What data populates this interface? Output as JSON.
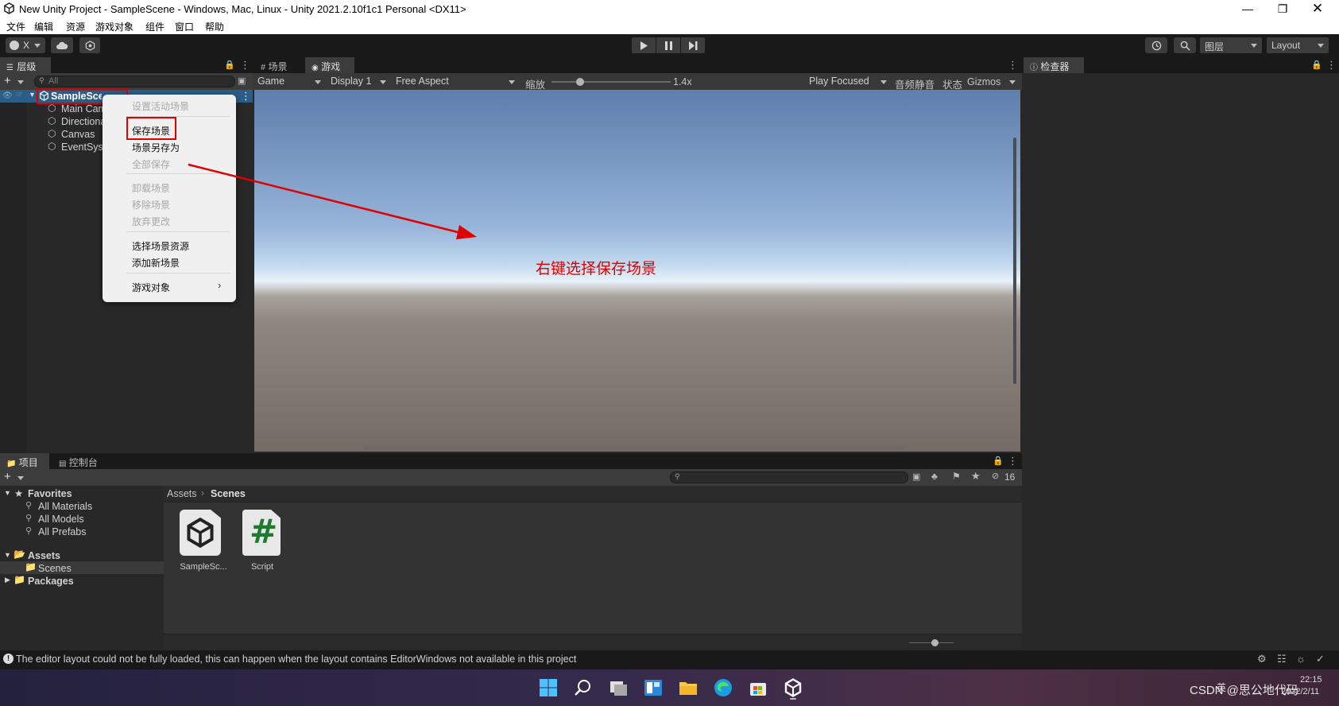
{
  "window": {
    "title": "New Unity Project - SampleScene - Windows, Mac, Linux - Unity 2021.2.10f1c1 Personal <DX11>"
  },
  "menubar": [
    "文件",
    "编辑",
    "资源",
    "游戏对象",
    "组件",
    "窗口",
    "帮助"
  ],
  "toolbar": {
    "account_label": "X",
    "layers_label": "图层",
    "layout_label": "Layout"
  },
  "hierarchy": {
    "tab_label": "层级",
    "search_placeholder": "All",
    "scene_name": "SampleScene",
    "items": [
      "Main Camera",
      "Directional Light",
      "Canvas",
      "EventSystem"
    ]
  },
  "context_menu": {
    "items": [
      {
        "label": "设置活动场景",
        "enabled": false
      },
      {
        "label": "保存场景",
        "enabled": true,
        "highlighted": true
      },
      {
        "label": "场景另存为",
        "enabled": true
      },
      {
        "label": "全部保存",
        "enabled": false
      },
      {
        "label": "卸载场景",
        "enabled": false
      },
      {
        "label": "移除场景",
        "enabled": false
      },
      {
        "label": "放弃更改",
        "enabled": false
      },
      {
        "label": "选择场景资源",
        "enabled": true
      },
      {
        "label": "添加新场景",
        "enabled": true
      },
      {
        "label": "游戏对象",
        "enabled": true,
        "submenu": true
      }
    ]
  },
  "game_view": {
    "tabs": [
      "场景",
      "游戏"
    ],
    "mode": "Game",
    "display": "Display 1",
    "aspect": "Free Aspect",
    "scale_label": "缩放",
    "scale_value": "1.4x",
    "play_mode": "Play Focused",
    "mute_label": "音频静音",
    "stats_label": "状态",
    "gizmos_label": "Gizmos",
    "annotation": "右键选择保存场景"
  },
  "inspector": {
    "tab_label": "检查器"
  },
  "project": {
    "tabs": [
      "项目",
      "控制台"
    ],
    "hidden_count": "16",
    "favorites_label": "Favorites",
    "favorites": [
      "All Materials",
      "All Models",
      "All Prefabs"
    ],
    "assets_label": "Assets",
    "assets_children": [
      "Scenes"
    ],
    "packages_label": "Packages",
    "breadcrumb": [
      "Assets",
      "Scenes"
    ],
    "files": [
      {
        "name": "SampleSc...",
        "icon": "unity-scene-icon"
      },
      {
        "name": "Script",
        "icon": "csharp-script-icon"
      }
    ]
  },
  "status_bar": {
    "message": "The editor layout could not be fully loaded, this can happen when the layout contains EditorWindows not available in this project"
  },
  "taskbar": {
    "apps": [
      "windows-start-icon",
      "search-icon",
      "task-view-icon",
      "widgets-icon",
      "file-explorer-icon",
      "edge-icon",
      "store-icon",
      "unity-icon"
    ],
    "watermark": "CSDN @思公地代码",
    "time": "22:15",
    "date": "2022/2/11",
    "ime": "英"
  },
  "colors": {
    "highlight_box": "#e00000",
    "annotation_text": "#e00000",
    "selection": "#2c5d87"
  }
}
